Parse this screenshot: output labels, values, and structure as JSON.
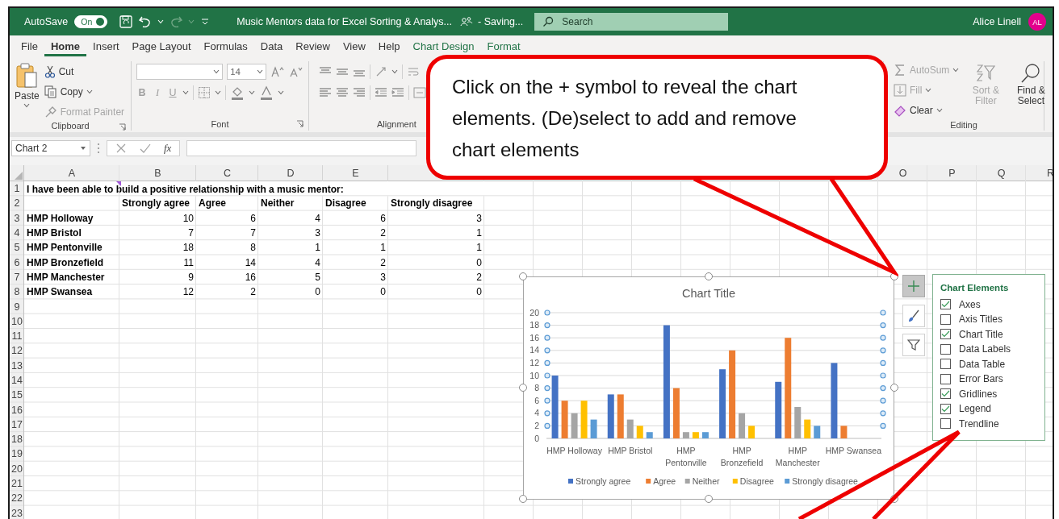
{
  "title_bar": {
    "autosave_label": "AutoSave",
    "autosave_toggle": {
      "label": "On",
      "on": true
    },
    "document_title": "Music Mentors data for Excel Sorting & Analys...",
    "save_status": "- Saving...",
    "search": {
      "placeholder": "Search"
    },
    "user_name": "Alice Linell",
    "avatar_initials": "AL"
  },
  "ribbon_tabs": [
    {
      "label": "File",
      "selected": false,
      "kind": "standard"
    },
    {
      "label": "Home",
      "selected": true,
      "kind": "standard"
    },
    {
      "label": "Insert",
      "selected": false,
      "kind": "standard"
    },
    {
      "label": "Page Layout",
      "selected": false,
      "kind": "standard"
    },
    {
      "label": "Formulas",
      "selected": false,
      "kind": "standard"
    },
    {
      "label": "Data",
      "selected": false,
      "kind": "standard"
    },
    {
      "label": "Review",
      "selected": false,
      "kind": "standard"
    },
    {
      "label": "View",
      "selected": false,
      "kind": "standard"
    },
    {
      "label": "Help",
      "selected": false,
      "kind": "standard"
    },
    {
      "label": "Chart Design",
      "selected": false,
      "kind": "contextual"
    },
    {
      "label": "Format",
      "selected": false,
      "kind": "contextual"
    }
  ],
  "ribbon": {
    "clipboard": {
      "label": "Clipboard",
      "paste": {
        "label": "Paste",
        "disabled": false
      },
      "commands": [
        {
          "label": "Cut",
          "disabled": false
        },
        {
          "label": "Copy",
          "disabled": false
        },
        {
          "label": "Format Painter",
          "disabled": true
        }
      ]
    },
    "font": {
      "label": "Font",
      "size": "14",
      "styles": [
        {
          "label": "B",
          "disabled": true
        },
        {
          "label": "I",
          "disabled": true
        },
        {
          "label": "U",
          "disabled": true
        }
      ]
    },
    "alignment": {
      "label": "Alignment"
    },
    "editing": {
      "label": "Editing",
      "commands": [
        {
          "label": "AutoSum",
          "disabled": true
        },
        {
          "label": "Fill",
          "disabled": true
        },
        {
          "label": "Clear",
          "disabled": false
        }
      ],
      "sort_filter": {
        "label": "Sort & Filter",
        "disabled": true
      },
      "find_select": {
        "label": "Find & Select",
        "disabled": false
      }
    }
  },
  "formula_bar": {
    "name_box": "Chart 2",
    "function_label": "fx"
  },
  "sheet": {
    "column_headers": [
      "A",
      "B",
      "C",
      "D",
      "E",
      "O",
      "P",
      "Q",
      "R"
    ],
    "title_row": {
      "number": "1",
      "text": "I have been able to build a positive relationship with a music mentor:"
    },
    "header_row": {
      "number": "2",
      "labels": [
        "Strongly agree",
        "Agree",
        "Neither",
        "Disagree",
        "Strongly disagree"
      ]
    },
    "data_rows": [
      {
        "number": "3",
        "label": "HMP Holloway",
        "values": [
          "10",
          "6",
          "4",
          "6",
          "3"
        ]
      },
      {
        "number": "4",
        "label": "HMP Bristol",
        "values": [
          "7",
          "7",
          "3",
          "2",
          "1"
        ]
      },
      {
        "number": "5",
        "label": "HMP Pentonville",
        "values": [
          "18",
          "8",
          "1",
          "1",
          "1"
        ]
      },
      {
        "number": "6",
        "label": "HMP Bronzefield",
        "values": [
          "11",
          "14",
          "4",
          "2",
          "0"
        ]
      },
      {
        "number": "7",
        "label": "HMP Manchester",
        "values": [
          "9",
          "16",
          "5",
          "3",
          "2"
        ]
      },
      {
        "number": "8",
        "label": "HMP Swansea",
        "values": [
          "12",
          "2",
          "0",
          "0",
          "0"
        ]
      }
    ],
    "empty_rows": [
      "9",
      "10",
      "11",
      "12",
      "13",
      "14",
      "15",
      "16",
      "17",
      "18",
      "19",
      "20",
      "21",
      "22",
      "23"
    ]
  },
  "chart": {
    "chart_data": {
      "type": "bar",
      "title": "Chart Title",
      "categories": [
        "HMP Holloway",
        "HMP Bristol",
        "HMP Pentonville",
        "HMP Bronzefield",
        "HMP Manchester",
        "HMP Swansea"
      ],
      "series": [
        {
          "name": "Strongly agree",
          "color": "#4472c4",
          "values": [
            10,
            7,
            18,
            11,
            9,
            12
          ]
        },
        {
          "name": "Agree",
          "color": "#ed7d31",
          "values": [
            6,
            7,
            8,
            14,
            16,
            2
          ]
        },
        {
          "name": "Neither",
          "color": "#a5a5a5",
          "values": [
            4,
            3,
            1,
            4,
            5,
            0
          ]
        },
        {
          "name": "Disagree",
          "color": "#ffc000",
          "values": [
            6,
            2,
            1,
            2,
            3,
            0
          ]
        },
        {
          "name": "Strongly disagree",
          "color": "#5b9bd5",
          "values": [
            3,
            1,
            1,
            0,
            2,
            0
          ]
        }
      ],
      "ylim": [
        0,
        20
      ],
      "yticks": [
        0,
        2,
        4,
        6,
        8,
        10,
        12,
        14,
        16,
        18,
        20
      ],
      "grid": true,
      "legend": "bottom"
    }
  },
  "chart_elements": {
    "title": "Chart Elements",
    "items": [
      {
        "label": "Axes",
        "checked": true
      },
      {
        "label": "Axis Titles",
        "checked": false
      },
      {
        "label": "Chart Title",
        "checked": true
      },
      {
        "label": "Data Labels",
        "checked": false
      },
      {
        "label": "Data Table",
        "checked": false
      },
      {
        "label": "Error Bars",
        "checked": false
      },
      {
        "label": "Gridlines",
        "checked": true
      },
      {
        "label": "Legend",
        "checked": true
      },
      {
        "label": "Trendline",
        "checked": false
      }
    ]
  },
  "callout": {
    "text": "Click on the + symbol to reveal the chart elements. (De)select to add and remove chart elements"
  }
}
